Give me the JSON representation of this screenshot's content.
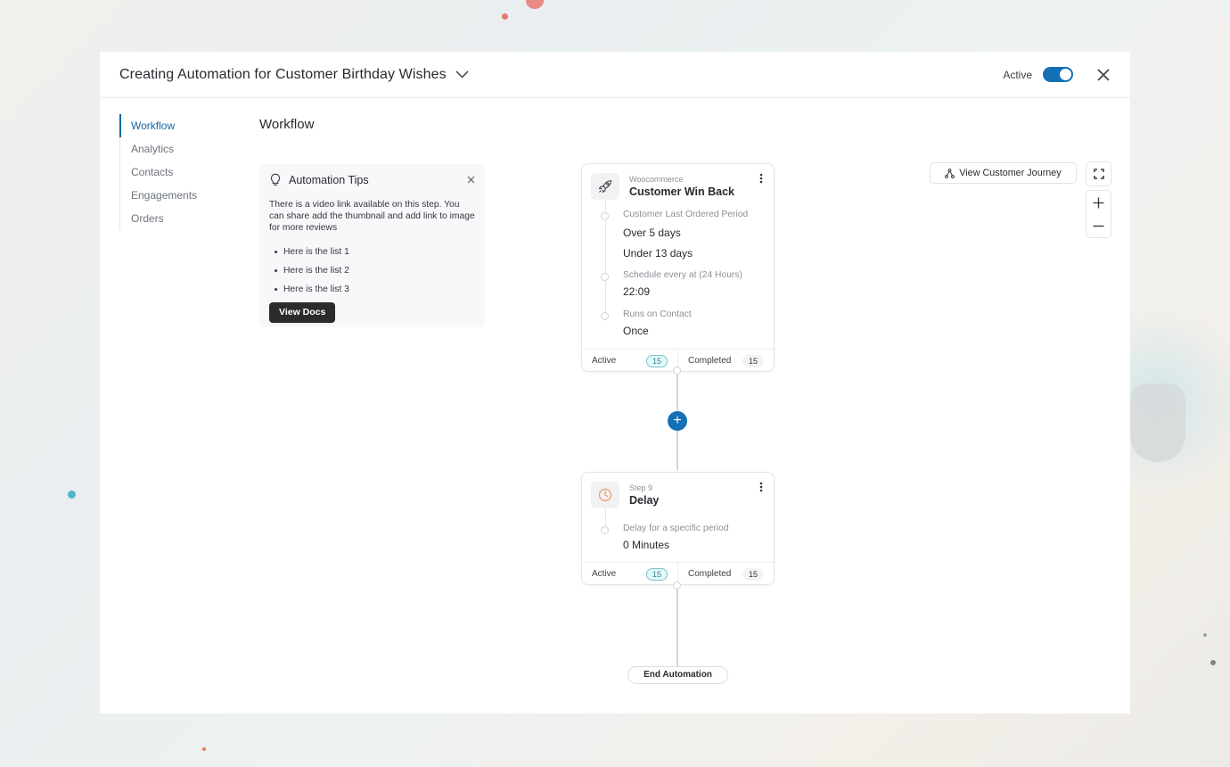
{
  "header": {
    "title": "Creating Automation for Customer Birthday Wishes",
    "status_label": "Active"
  },
  "toggle": {
    "on": true,
    "accent": "#1470b5"
  },
  "sidebar": {
    "items": [
      {
        "label": "Workflow",
        "active": true
      },
      {
        "label": "Analytics"
      },
      {
        "label": "Contacts"
      },
      {
        "label": "Engagements"
      },
      {
        "label": "Orders"
      }
    ]
  },
  "main": {
    "section_title": "Workflow"
  },
  "tips": {
    "title": "Automation Tips",
    "text": "There is a video link available on this step. You can share add the thumbnail and add link to image for more reviews",
    "list": [
      "Here is the list 1",
      "Here is the list 2",
      "Here is the list 3"
    ],
    "button_label": "View Docs"
  },
  "nodes": [
    {
      "icon": "rocket-icon",
      "source": "Woocommerce",
      "name": "Customer Win Back",
      "fields": [
        {
          "label": "Customer Last Ordered Period",
          "values": [
            "Over 5 days",
            "Under 13 days"
          ]
        },
        {
          "label": "Schedule every at (24 Hours)",
          "values": [
            "22:09"
          ]
        },
        {
          "label": "Runs on Contact",
          "values": [
            "Once"
          ]
        }
      ],
      "active_label": "Active",
      "active_count": "15",
      "completed_label": "Completed",
      "completed_count": "15"
    },
    {
      "icon": "clock-icon",
      "source": "Step 9",
      "name": "Delay",
      "fields": [
        {
          "label": "Delay for a specific period",
          "values": [
            "0 Minutes"
          ]
        }
      ],
      "active_label": "Active",
      "active_count": "15",
      "completed_label": "Completed",
      "completed_count": "15"
    }
  ],
  "add_step": {
    "glyph": "+"
  },
  "end_label": "End Automation",
  "canvas_tools": {
    "journey_label": "View Customer Journey",
    "icons": [
      "fullscreen-icon",
      "zoom-in-icon",
      "zoom-out-icon"
    ]
  }
}
